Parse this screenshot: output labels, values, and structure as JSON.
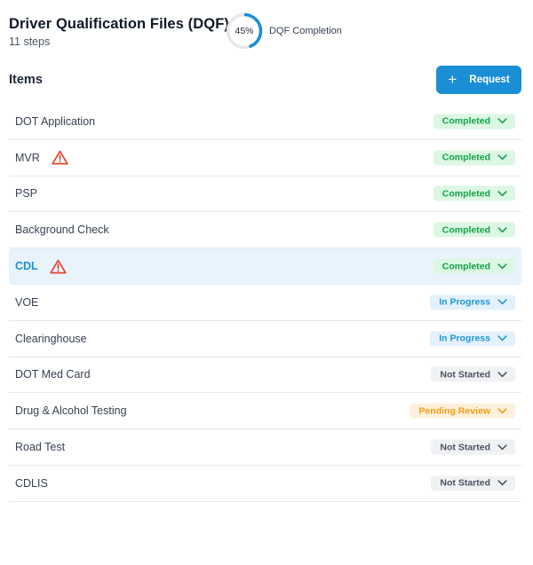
{
  "header": {
    "title": "Driver Qualification Files (DQF)",
    "steps": "11 steps",
    "progress": {
      "percent": 45,
      "label": "45%",
      "caption": "DQF Completion"
    }
  },
  "items_section": {
    "heading": "Items",
    "request_button": {
      "icon": "plus-icon",
      "label": "Request"
    }
  },
  "colors": {
    "accent": "#1a8fd6",
    "completed": "#15a34a",
    "in_progress": "#2196d8",
    "not_started": "#4b5563",
    "pending_review": "#f39c12",
    "warning": "#e5432d"
  },
  "items": [
    {
      "label": "DOT Application",
      "status": "Completed",
      "status_type": "completed",
      "warning": false,
      "selected": false
    },
    {
      "label": "MVR",
      "status": "Completed",
      "status_type": "completed",
      "warning": true,
      "selected": false
    },
    {
      "label": "PSP",
      "status": "Completed",
      "status_type": "completed",
      "warning": false,
      "selected": false
    },
    {
      "label": "Background Check",
      "status": "Completed",
      "status_type": "completed",
      "warning": false,
      "selected": false
    },
    {
      "label": "CDL",
      "status": "Completed",
      "status_type": "completed",
      "warning": true,
      "selected": true
    },
    {
      "label": "VOE",
      "status": "In Progress",
      "status_type": "progress",
      "warning": false,
      "selected": false
    },
    {
      "label": "Clearinghouse",
      "status": "In Progress",
      "status_type": "progress",
      "warning": false,
      "selected": false
    },
    {
      "label": "DOT Med Card",
      "status": "Not Started",
      "status_type": "notstarted",
      "warning": false,
      "selected": false
    },
    {
      "label": "Drug & Alcohol Testing",
      "status": "Pending Review",
      "status_type": "pending",
      "warning": false,
      "selected": false
    },
    {
      "label": "Road Test",
      "status": "Not Started",
      "status_type": "notstarted",
      "warning": false,
      "selected": false
    },
    {
      "label": "CDLIS",
      "status": "Not Started",
      "status_type": "notstarted",
      "warning": false,
      "selected": false
    }
  ]
}
